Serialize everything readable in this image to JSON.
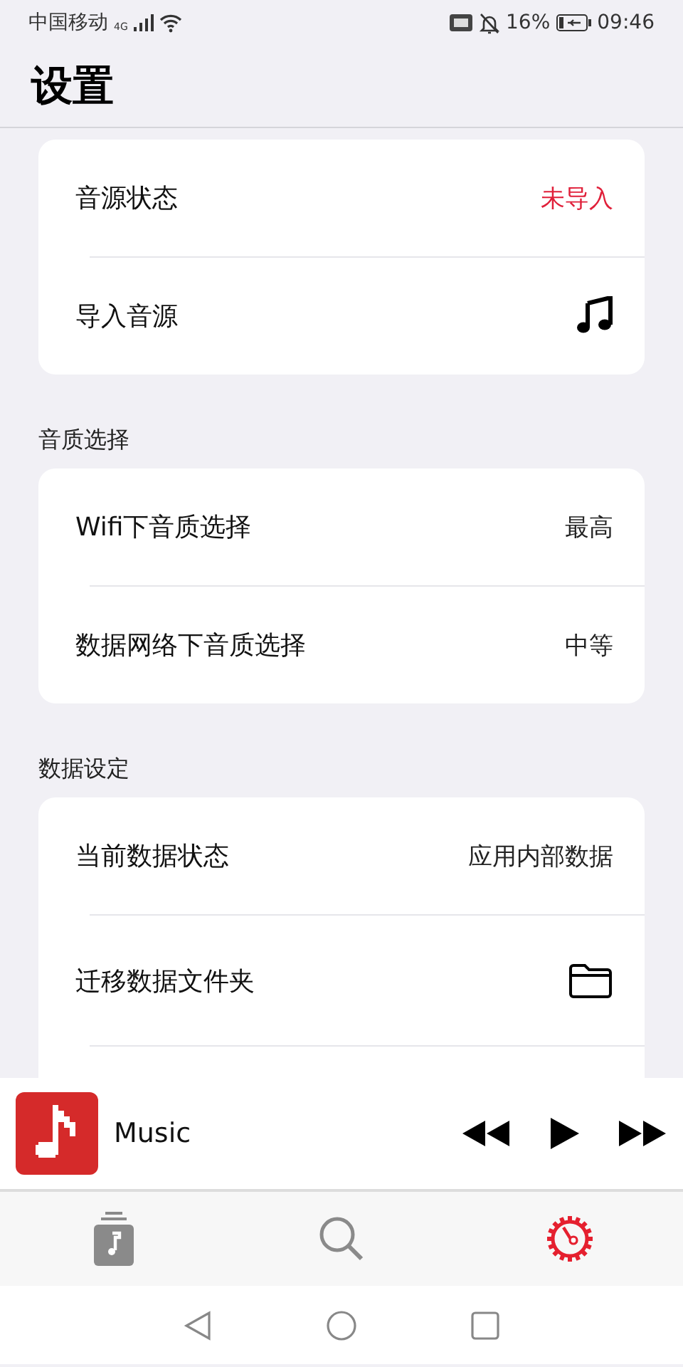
{
  "status_bar": {
    "carrier": "中国移动",
    "network": "4G",
    "battery": "16%",
    "time": "09:46"
  },
  "title": "设置",
  "sections": [
    {
      "rows": [
        {
          "label": "音源状态",
          "kind": "alert",
          "value": "未导入"
        },
        {
          "label": "导入音源",
          "kind": "note"
        }
      ]
    },
    {
      "header": "音质选择",
      "rows": [
        {
          "label": "Wifi下音质选择",
          "kind": "value",
          "value": "最高"
        },
        {
          "label": "数据网络下音质选择",
          "kind": "value",
          "value": "中等"
        }
      ]
    },
    {
      "header": "数据设定",
      "rows": [
        {
          "label": "当前数据状态",
          "kind": "value",
          "value": "应用内部数据"
        },
        {
          "label": "迁移数据文件夹",
          "kind": "folder"
        }
      ]
    }
  ],
  "player": {
    "title": "Music"
  },
  "tabs": [
    {
      "kind": "library",
      "selected": false
    },
    {
      "kind": "search",
      "selected": false
    },
    {
      "kind": "settings",
      "selected": true
    }
  ]
}
